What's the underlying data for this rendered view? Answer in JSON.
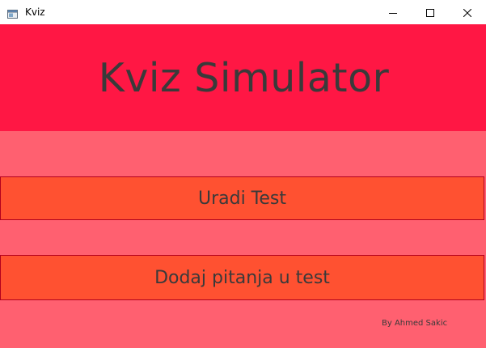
{
  "window": {
    "title": "Kviz",
    "app_icon": "window-app-icon",
    "controls": {
      "minimize_icon": "minimize-icon",
      "maximize_icon": "maximize-icon",
      "close_icon": "close-icon"
    }
  },
  "header": {
    "title": "Kviz Simulator"
  },
  "buttons": {
    "take_test": "Uradi Test",
    "add_questions": "Dodaj pitanja u test"
  },
  "footer": {
    "credit": "By Ahmed Sakic"
  },
  "colors": {
    "background": "#ff6070",
    "header_band": "#ff1744",
    "button_fill": "#ff5131",
    "button_border": "#b3001e",
    "text": "#3a3a3a"
  }
}
